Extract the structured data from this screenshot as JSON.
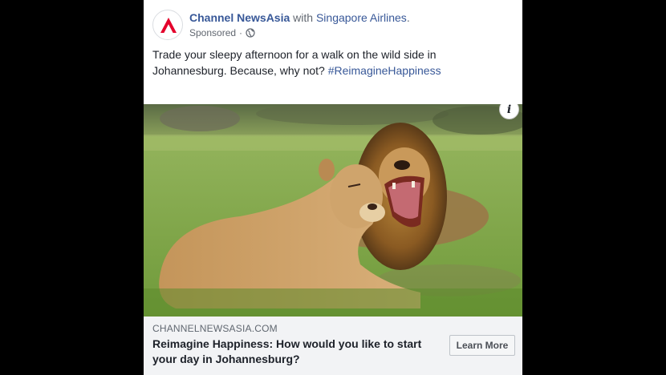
{
  "post": {
    "page_name": "Channel NewsAsia",
    "with_text": " with ",
    "partner_name": "Singapore Airlines",
    "partner_suffix": ".",
    "sponsored_label": "Sponsored",
    "separator": "·",
    "privacy_icon": "globe-icon",
    "body_text": "Trade your sleepy afternoon for a walk on the wild side in Johannesburg. Because, why not? ",
    "hashtag": "#ReimagineHappiness"
  },
  "image": {
    "info_label": "i",
    "info_icon": "info-icon"
  },
  "link": {
    "domain": "CHANNELNEWSASIA.COM",
    "headline": "Reimagine Happiness: How would you like to start your day in Johannesburg?",
    "cta_label": "Learn More"
  },
  "colors": {
    "link_blue": "#385898",
    "logo_red": "#e4002b",
    "background": "#000000"
  }
}
